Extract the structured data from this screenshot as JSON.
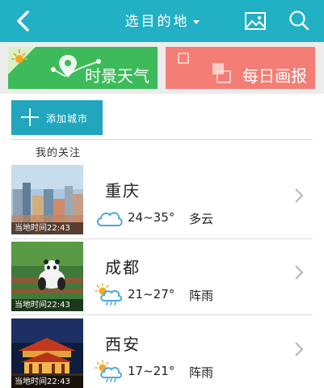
{
  "header": {
    "title": "选目的地",
    "bg_color": "#21b0c4",
    "back_icon": "chevron-left-icon",
    "image_icon": "image-icon",
    "search_icon": "search-icon"
  },
  "tabs": [
    {
      "label": "时景天气",
      "color": "#3dbb5a",
      "icon": "sun-map-pin-icon"
    },
    {
      "label": "每日画报",
      "color": "#f47d76",
      "icon": "squares-icon"
    }
  ],
  "add_city_label": "添加城市",
  "section_title": "我的关注",
  "cities": [
    {
      "name": "重庆",
      "temp": "24~35°",
      "condition": "多云",
      "time": "当地时间22:43",
      "weather_icon": "cloud-icon"
    },
    {
      "name": "成都",
      "temp": "21~27°",
      "condition": "阵雨",
      "time": "当地时间22:43",
      "weather_icon": "sun-cloud-rain-icon"
    },
    {
      "name": "西安",
      "temp": "17~21°",
      "condition": "阵雨",
      "time": "当地时间22:43",
      "weather_icon": "sun-cloud-rain-icon"
    }
  ]
}
